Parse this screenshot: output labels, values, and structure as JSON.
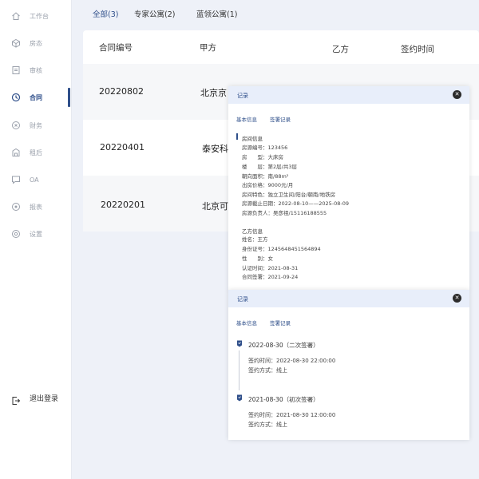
{
  "sidebar": {
    "items": [
      {
        "label": "工作台",
        "icon": "home-icon"
      },
      {
        "label": "房态",
        "icon": "cube-icon"
      },
      {
        "label": "审核",
        "icon": "document-icon"
      },
      {
        "label": "合同",
        "icon": "clock-icon"
      },
      {
        "label": "财务",
        "icon": "coin-icon"
      },
      {
        "label": "租后",
        "icon": "building-icon"
      },
      {
        "label": "OA",
        "icon": "message-icon"
      },
      {
        "label": "报表",
        "icon": "report-icon"
      },
      {
        "label": "设置",
        "icon": "gear-icon"
      }
    ],
    "active_index": 3,
    "logout_label": "退出登录"
  },
  "tabs": [
    {
      "label": "全部(3)",
      "active": true
    },
    {
      "label": "专家公寓(2)",
      "active": false
    },
    {
      "label": "蓝领公寓(1)",
      "active": false
    }
  ],
  "table": {
    "headers": [
      "合同编号",
      "甲方",
      "乙方",
      "签约时间"
    ],
    "rows": [
      {
        "contract_no": "20220802",
        "party_a": "北京京"
      },
      {
        "contract_no": "20220401",
        "party_a": "泰安科"
      },
      {
        "contract_no": "20220201",
        "party_a": "北京可"
      }
    ]
  },
  "panel1": {
    "title": "记录",
    "tabs": [
      "基本信息",
      "签署记录"
    ],
    "room_section": "房间信息",
    "room_info": [
      "房源编号：123456",
      "房　　型：大床房",
      "楼　　层：第2层/共3层",
      "朝向面积：南/88m²",
      "出房价格：9000元/月",
      "房间特色：独立卫生间/阳台/朝南/地铁房",
      "房源截止日期：2022-08-10——2025-08-09",
      "房源负责人：吴彦祖/15116188555"
    ],
    "party_b_section": "乙方信息",
    "party_b_info": [
      "姓名：王方",
      "身份证号：12456484515648​94",
      "性　　别：女",
      "认证时间：2021-08-31",
      "合同签署：2021-09-24"
    ]
  },
  "panel2": {
    "title": "记录",
    "tabs": [
      "基本信息",
      "签署记录"
    ],
    "timeline": [
      {
        "title": "2022-08-30（二次签署）",
        "time": "签约时间：2022-08-30 22:00:00",
        "method": "签约方式：线上"
      },
      {
        "title": "2021-08-30（初次签署）",
        "time": "签约时间：2021-08-30 12:00:00",
        "method": "签约方式：线上"
      }
    ]
  },
  "colors": {
    "accent": "#2f4f8a",
    "panel_header": "#e8eefa",
    "background": "#eef1f8"
  }
}
